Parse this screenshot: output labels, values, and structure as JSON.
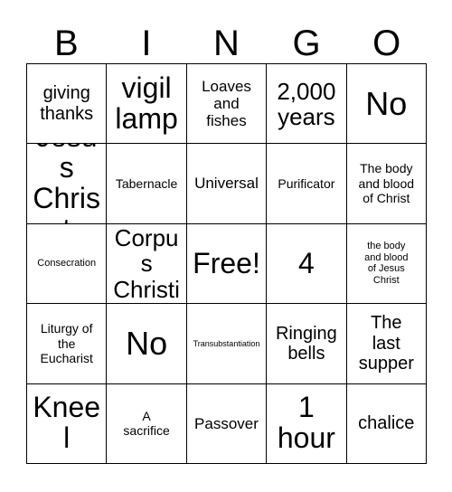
{
  "card": {
    "title": "BINGO Card",
    "header_letters": [
      "B",
      "I",
      "N",
      "G",
      "O"
    ],
    "free_space_label": "Free!",
    "grid_size": "5x5",
    "colors": {
      "background": "#ffffff",
      "text": "#000000",
      "border": "#000000"
    },
    "rows": [
      {
        "cells": [
          {
            "text": "giving\nthanks",
            "size": "fs-l"
          },
          {
            "text": "vigil\nlamp",
            "size": "fs-xxl"
          },
          {
            "text": "Loaves\nand\nfishes",
            "size": "fs-m"
          },
          {
            "text": "2,000\nyears",
            "size": "fs-xl"
          },
          {
            "text": "No",
            "size": "fs-huge"
          }
        ]
      },
      {
        "cells": [
          {
            "text": "Jesus\nChrist",
            "size": "fs-xxl"
          },
          {
            "text": "Tabernacle",
            "size": "fs-s"
          },
          {
            "text": "Universal",
            "size": "fs-m"
          },
          {
            "text": "Purificator",
            "size": "fs-s"
          },
          {
            "text": "The body\nand blood\nof Christ",
            "size": "fs-s"
          }
        ]
      },
      {
        "cells": [
          {
            "text": "Consecration",
            "size": "fs-xs"
          },
          {
            "text": "Corpus\nChristi",
            "size": "fs-xl"
          },
          {
            "text": "Free!",
            "size": "fs-xxl"
          },
          {
            "text": "4",
            "size": "fs-xxl"
          },
          {
            "text": "the body\nand blood\nof Jesus\nChrist",
            "size": "fs-xs"
          }
        ]
      },
      {
        "cells": [
          {
            "text": "Liturgy of\nthe\nEucharist",
            "size": "fs-s"
          },
          {
            "text": "No",
            "size": "fs-huge"
          },
          {
            "text": "Transubstantiation",
            "size": "fs-xxs"
          },
          {
            "text": "Ringing\nbells",
            "size": "fs-l"
          },
          {
            "text": "The\nlast\nsupper",
            "size": "fs-l"
          }
        ]
      },
      {
        "cells": [
          {
            "text": "Kneel",
            "size": "fs-xxl"
          },
          {
            "text": "A\nsacrifice",
            "size": "fs-s"
          },
          {
            "text": "Passover",
            "size": "fs-m"
          },
          {
            "text": "1\nhour",
            "size": "fs-xxl"
          },
          {
            "text": "chalice",
            "size": "fs-l"
          }
        ]
      }
    ]
  }
}
